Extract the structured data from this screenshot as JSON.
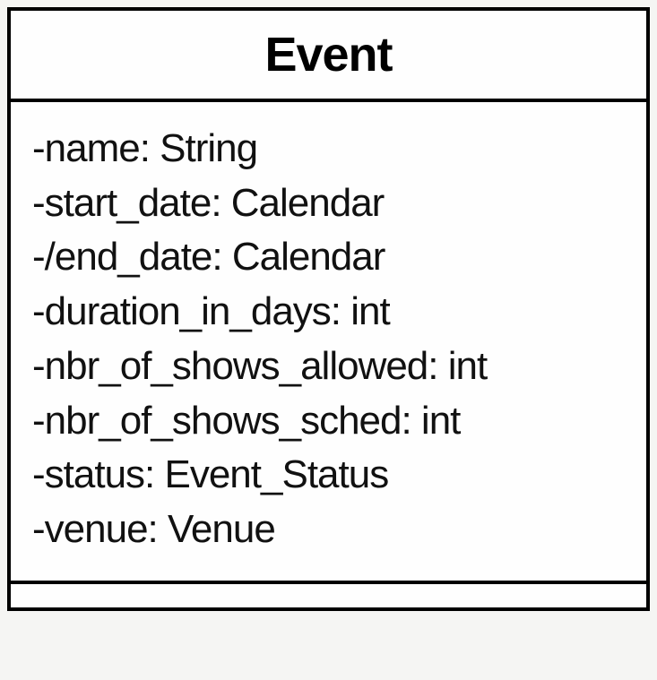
{
  "class": {
    "name": "Event",
    "attributes": [
      "-name: String",
      "-start_date: Calendar",
      "-/end_date: Calendar",
      "-duration_in_days: int",
      "-nbr_of_shows_allowed: int",
      "-nbr_of_shows_sched: int",
      "-status: Event_Status",
      "-venue: Venue"
    ]
  }
}
